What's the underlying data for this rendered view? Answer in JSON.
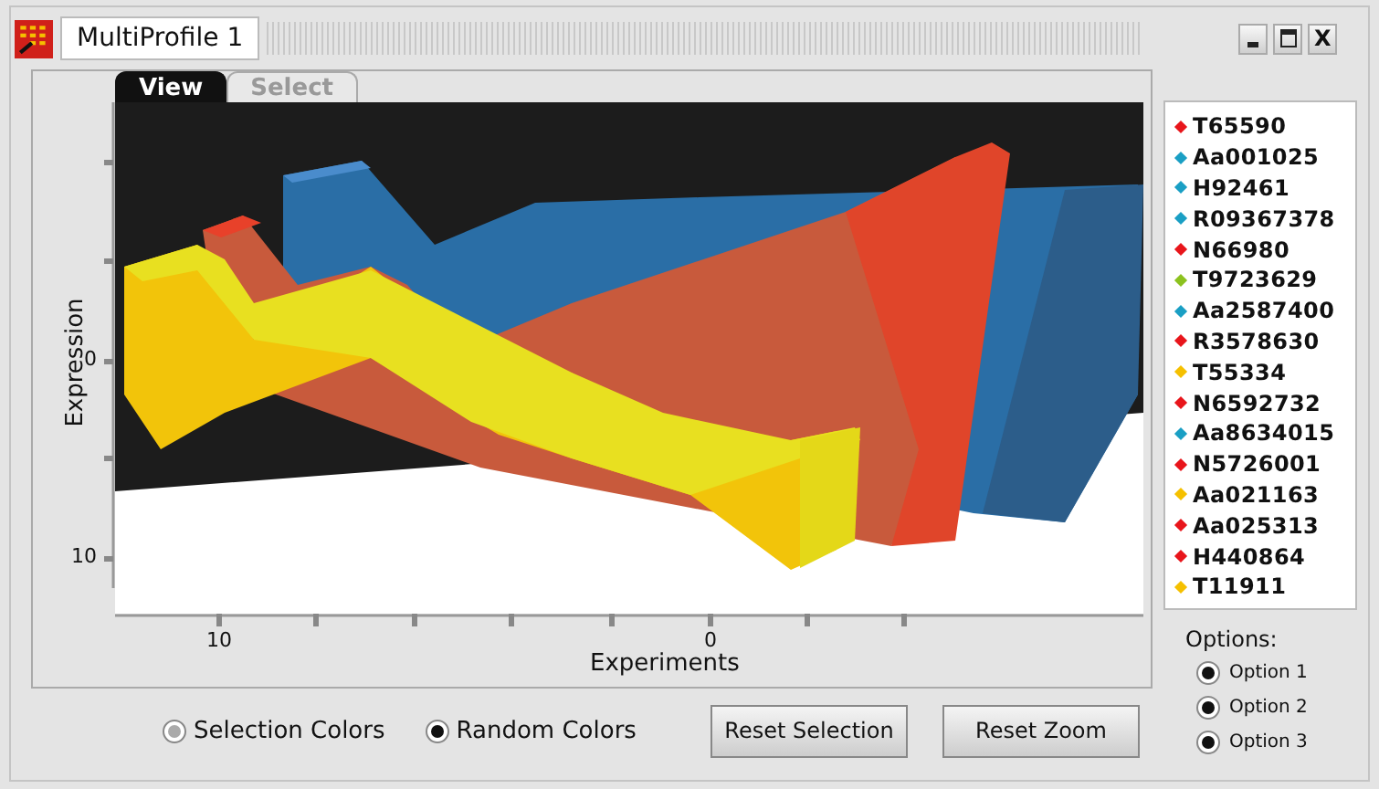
{
  "window": {
    "title": "MultiProfile 1",
    "close_label": "X"
  },
  "tabs": [
    {
      "label": "View",
      "selected": true
    },
    {
      "label": "Select",
      "selected": false
    }
  ],
  "y_axis": {
    "label": "Expression",
    "ticks": [
      "0",
      "10"
    ]
  },
  "x_axis": {
    "label": "Experiments",
    "ticks": [
      "10",
      "0"
    ]
  },
  "legend": [
    {
      "label": "T65590",
      "color": "#e8151b"
    },
    {
      "label": "Aa001025",
      "color": "#1a9fc4"
    },
    {
      "label": "H92461",
      "color": "#1a9fc4"
    },
    {
      "label": "R09367378",
      "color": "#1a9fc4"
    },
    {
      "label": "N66980",
      "color": "#e8151b"
    },
    {
      "label": "T9723629",
      "color": "#8cc21f"
    },
    {
      "label": "Aa2587400",
      "color": "#1a9fc4"
    },
    {
      "label": "R3578630",
      "color": "#e8151b"
    },
    {
      "label": "T55334",
      "color": "#f5c000"
    },
    {
      "label": "N6592732",
      "color": "#e8151b"
    },
    {
      "label": "Aa8634015",
      "color": "#1a9fc4"
    },
    {
      "label": "N5726001",
      "color": "#e8151b"
    },
    {
      "label": "Aa021163",
      "color": "#f5c000"
    },
    {
      "label": "Aa025313",
      "color": "#e8151b"
    },
    {
      "label": "H440864",
      "color": "#e8151b"
    },
    {
      "label": "T11911",
      "color": "#f5c000"
    }
  ],
  "color_modes": [
    {
      "label": "Selection Colors",
      "selected": true,
      "disabled": true
    },
    {
      "label": "Random Colors",
      "selected": true,
      "disabled": false
    }
  ],
  "buttons": [
    "Reset Selection",
    "Reset Zoom"
  ],
  "options": {
    "title": "Options:",
    "items": [
      {
        "label": "Option 1",
        "selected": true
      },
      {
        "label": "Option 2",
        "selected": true
      },
      {
        "label": "Option 3",
        "selected": true
      }
    ]
  }
}
